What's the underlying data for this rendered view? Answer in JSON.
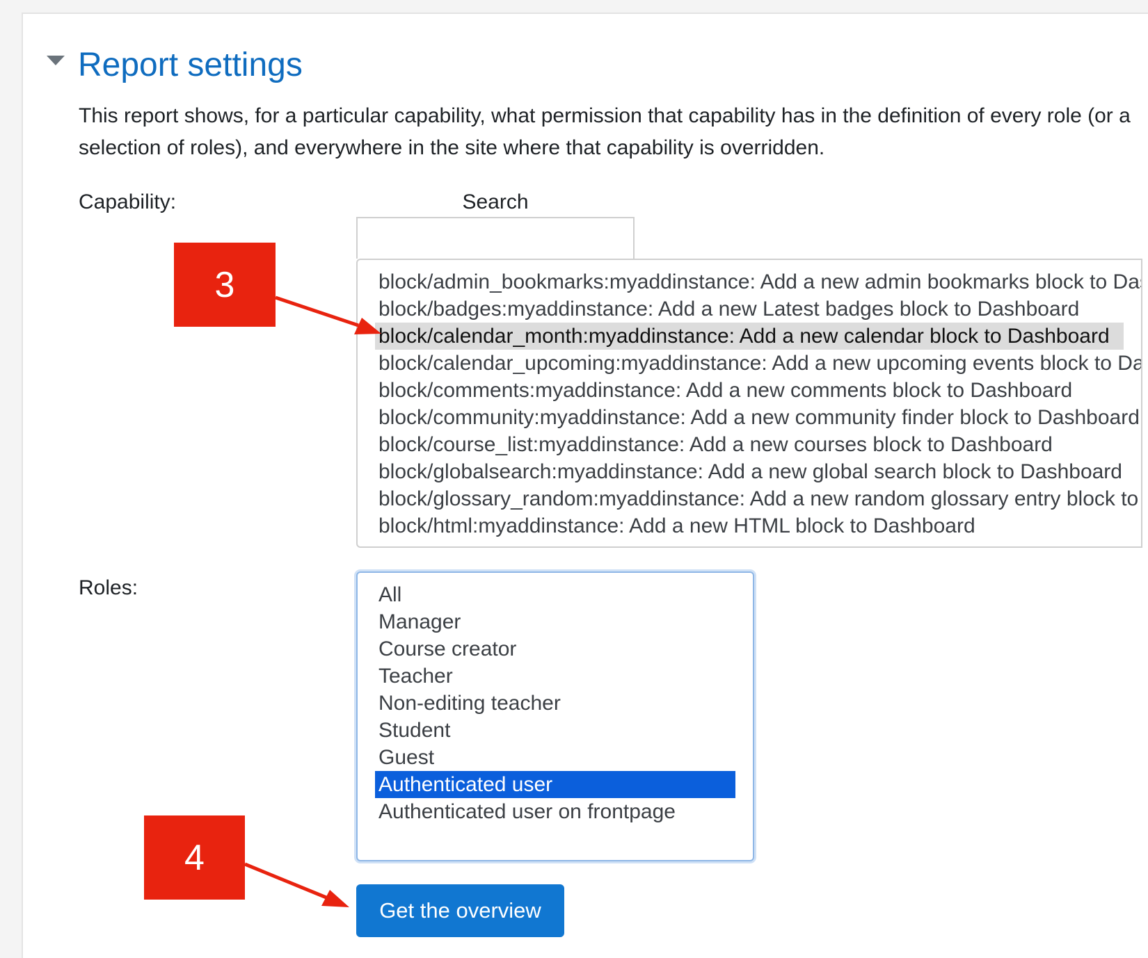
{
  "section": {
    "title": "Report settings",
    "description": "This report shows, for a particular capability, what permission that capability has in the definition of every role (or a selection of roles), and everywhere in the site where that capability is overridden."
  },
  "capability": {
    "label": "Capability:",
    "search_label": "Search",
    "search_value": "",
    "options": [
      "block/admin_bookmarks:myaddinstance: Add a new admin bookmarks block to Dashboard",
      "block/badges:myaddinstance: Add a new Latest badges block to Dashboard",
      "block/calendar_month:myaddinstance: Add a new calendar block to Dashboard",
      "block/calendar_upcoming:myaddinstance: Add a new upcoming events block to Dashboard",
      "block/comments:myaddinstance: Add a new comments block to Dashboard",
      "block/community:myaddinstance: Add a new community finder block to Dashboard",
      "block/course_list:myaddinstance: Add a new courses block to Dashboard",
      "block/globalsearch:myaddinstance: Add a new global search block to Dashboard",
      "block/glossary_random:myaddinstance: Add a new random glossary entry block to Dashboard",
      "block/html:myaddinstance: Add a new HTML block to Dashboard"
    ],
    "selected": "block/calendar_month:myaddinstance: Add a new calendar block to Dashboard"
  },
  "roles": {
    "label": "Roles:",
    "options": [
      "All",
      "Manager",
      "Course creator",
      "Teacher",
      "Non-editing teacher",
      "Student",
      "Guest",
      "Authenticated user",
      "Authenticated user on frontpage"
    ],
    "selected": "Authenticated user"
  },
  "submit_label": "Get the overview",
  "annotations": {
    "step_3": "3",
    "step_4": "4",
    "color": "#e8230f"
  },
  "colors": {
    "title": "#0f6cbf",
    "button": "#1177d1",
    "selected_role": "#0b5fdc",
    "selected_capability": "#dcdcdc"
  }
}
